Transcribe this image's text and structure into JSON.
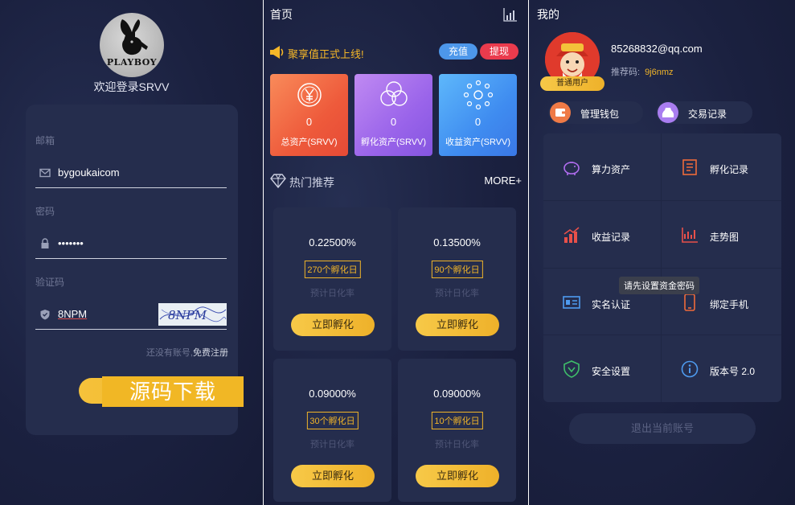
{
  "login": {
    "welcome": "欢迎登录SRVV",
    "logo_text": "PLAYBOY",
    "email_label": "邮箱",
    "email_value": "bygoukaicom",
    "password_label": "密码",
    "password_value": "•••••••",
    "captcha_label": "验证码",
    "captcha_value": "8NPM",
    "captcha_image_text": "8NPM",
    "register_prefix": "还没有账号,",
    "register_link": "免费注册",
    "watermark": "源码下载"
  },
  "home": {
    "title": "首页",
    "notice": "聚享值正式上线!",
    "recharge": "充值",
    "withdraw": "提现",
    "assets": [
      {
        "value": "0",
        "label": "总资产(SRVV)",
        "icon": "yen-coin-icon"
      },
      {
        "value": "0",
        "label": "孵化资产(SRVV)",
        "icon": "circles-icon"
      },
      {
        "value": "0",
        "label": "收益资产(SRVV)",
        "icon": "network-icon"
      }
    ],
    "hot_title": "热门推荐",
    "more": "MORE+",
    "products": [
      {
        "rate": "0.22500%",
        "days": "270个孵化日",
        "sub": "预计日化率",
        "button": "立即孵化"
      },
      {
        "rate": "0.13500%",
        "days": "90个孵化日",
        "sub": "预计日化率",
        "button": "立即孵化"
      },
      {
        "rate": "0.09000%",
        "days": "30个孵化日",
        "sub": "预计日化率",
        "button": "立即孵化"
      },
      {
        "rate": "0.09000%",
        "days": "10个孵化日",
        "sub": "预计日化率",
        "button": "立即孵化"
      }
    ]
  },
  "mine": {
    "title": "我的",
    "email": "85268832@qq.com",
    "ref_label": "推荐码:",
    "ref_code": "9j6nmz",
    "user_tag": "普通用户",
    "wallet": "管理钱包",
    "trades": "交易记录",
    "menu": [
      {
        "label": "算力资产",
        "icon": "piggy-bank-icon"
      },
      {
        "label": "孵化记录",
        "icon": "ledger-icon"
      },
      {
        "label": "收益记录",
        "icon": "bar-trend-icon"
      },
      {
        "label": "走势图",
        "icon": "line-chart-icon"
      },
      {
        "label": "实名认证",
        "icon": "id-card-icon"
      },
      {
        "label": "绑定手机",
        "icon": "phone-icon"
      },
      {
        "label": "安全设置",
        "icon": "shield-icon"
      },
      {
        "label": "版本号 2.0",
        "icon": "info-icon"
      }
    ],
    "tooltip": "请先设置资金密码",
    "logout": "退出当前账号"
  },
  "colors": {
    "accent": "#f0b429",
    "panel_bg": "#1b2140",
    "card_bg": "#252d4d"
  }
}
